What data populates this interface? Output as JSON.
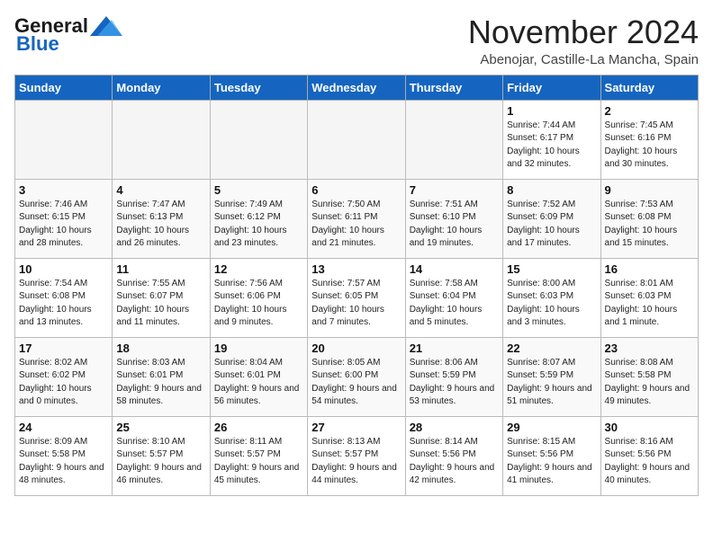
{
  "header": {
    "logo_general": "General",
    "logo_blue": "Blue",
    "month": "November 2024",
    "location": "Abenojar, Castille-La Mancha, Spain"
  },
  "weekdays": [
    "Sunday",
    "Monday",
    "Tuesday",
    "Wednesday",
    "Thursday",
    "Friday",
    "Saturday"
  ],
  "weeks": [
    [
      {
        "day": "",
        "empty": true
      },
      {
        "day": "",
        "empty": true
      },
      {
        "day": "",
        "empty": true
      },
      {
        "day": "",
        "empty": true
      },
      {
        "day": "",
        "empty": true
      },
      {
        "day": "1",
        "sunrise": "7:44 AM",
        "sunset": "6:17 PM",
        "daylight": "10 hours and 32 minutes."
      },
      {
        "day": "2",
        "sunrise": "7:45 AM",
        "sunset": "6:16 PM",
        "daylight": "10 hours and 30 minutes."
      }
    ],
    [
      {
        "day": "3",
        "sunrise": "7:46 AM",
        "sunset": "6:15 PM",
        "daylight": "10 hours and 28 minutes."
      },
      {
        "day": "4",
        "sunrise": "7:47 AM",
        "sunset": "6:13 PM",
        "daylight": "10 hours and 26 minutes."
      },
      {
        "day": "5",
        "sunrise": "7:49 AM",
        "sunset": "6:12 PM",
        "daylight": "10 hours and 23 minutes."
      },
      {
        "day": "6",
        "sunrise": "7:50 AM",
        "sunset": "6:11 PM",
        "daylight": "10 hours and 21 minutes."
      },
      {
        "day": "7",
        "sunrise": "7:51 AM",
        "sunset": "6:10 PM",
        "daylight": "10 hours and 19 minutes."
      },
      {
        "day": "8",
        "sunrise": "7:52 AM",
        "sunset": "6:09 PM",
        "daylight": "10 hours and 17 minutes."
      },
      {
        "day": "9",
        "sunrise": "7:53 AM",
        "sunset": "6:08 PM",
        "daylight": "10 hours and 15 minutes."
      }
    ],
    [
      {
        "day": "10",
        "sunrise": "7:54 AM",
        "sunset": "6:08 PM",
        "daylight": "10 hours and 13 minutes."
      },
      {
        "day": "11",
        "sunrise": "7:55 AM",
        "sunset": "6:07 PM",
        "daylight": "10 hours and 11 minutes."
      },
      {
        "day": "12",
        "sunrise": "7:56 AM",
        "sunset": "6:06 PM",
        "daylight": "10 hours and 9 minutes."
      },
      {
        "day": "13",
        "sunrise": "7:57 AM",
        "sunset": "6:05 PM",
        "daylight": "10 hours and 7 minutes."
      },
      {
        "day": "14",
        "sunrise": "7:58 AM",
        "sunset": "6:04 PM",
        "daylight": "10 hours and 5 minutes."
      },
      {
        "day": "15",
        "sunrise": "8:00 AM",
        "sunset": "6:03 PM",
        "daylight": "10 hours and 3 minutes."
      },
      {
        "day": "16",
        "sunrise": "8:01 AM",
        "sunset": "6:03 PM",
        "daylight": "10 hours and 1 minute."
      }
    ],
    [
      {
        "day": "17",
        "sunrise": "8:02 AM",
        "sunset": "6:02 PM",
        "daylight": "10 hours and 0 minutes."
      },
      {
        "day": "18",
        "sunrise": "8:03 AM",
        "sunset": "6:01 PM",
        "daylight": "9 hours and 58 minutes."
      },
      {
        "day": "19",
        "sunrise": "8:04 AM",
        "sunset": "6:01 PM",
        "daylight": "9 hours and 56 minutes."
      },
      {
        "day": "20",
        "sunrise": "8:05 AM",
        "sunset": "6:00 PM",
        "daylight": "9 hours and 54 minutes."
      },
      {
        "day": "21",
        "sunrise": "8:06 AM",
        "sunset": "5:59 PM",
        "daylight": "9 hours and 53 minutes."
      },
      {
        "day": "22",
        "sunrise": "8:07 AM",
        "sunset": "5:59 PM",
        "daylight": "9 hours and 51 minutes."
      },
      {
        "day": "23",
        "sunrise": "8:08 AM",
        "sunset": "5:58 PM",
        "daylight": "9 hours and 49 minutes."
      }
    ],
    [
      {
        "day": "24",
        "sunrise": "8:09 AM",
        "sunset": "5:58 PM",
        "daylight": "9 hours and 48 minutes."
      },
      {
        "day": "25",
        "sunrise": "8:10 AM",
        "sunset": "5:57 PM",
        "daylight": "9 hours and 46 minutes."
      },
      {
        "day": "26",
        "sunrise": "8:11 AM",
        "sunset": "5:57 PM",
        "daylight": "9 hours and 45 minutes."
      },
      {
        "day": "27",
        "sunrise": "8:13 AM",
        "sunset": "5:57 PM",
        "daylight": "9 hours and 44 minutes."
      },
      {
        "day": "28",
        "sunrise": "8:14 AM",
        "sunset": "5:56 PM",
        "daylight": "9 hours and 42 minutes."
      },
      {
        "day": "29",
        "sunrise": "8:15 AM",
        "sunset": "5:56 PM",
        "daylight": "9 hours and 41 minutes."
      },
      {
        "day": "30",
        "sunrise": "8:16 AM",
        "sunset": "5:56 PM",
        "daylight": "9 hours and 40 minutes."
      }
    ]
  ]
}
